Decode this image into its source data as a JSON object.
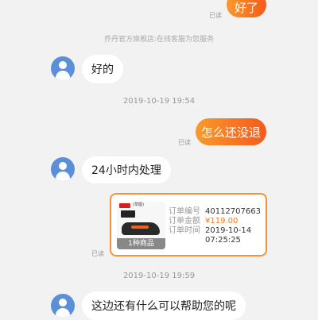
{
  "messages": {
    "m1": {
      "text": "好了",
      "read": "已读"
    },
    "system_notice": "乔丹官方旗舰店:在线客服为您服务",
    "m2": {
      "text": "好的"
    },
    "ts1": "2019-10-19 19:54",
    "m3": {
      "text": "怎么还没退",
      "read": "已读"
    },
    "m4": {
      "text": "24小时内处理"
    },
    "order_card": {
      "thumb_count": "1种商品",
      "brand_label": "(草图)",
      "order_no_label": "订单编号",
      "order_no": "40112707663",
      "amount_label": "订单金额",
      "amount": "¥119.00",
      "time_label": "订单时间",
      "time_date": "2019-10-14",
      "time_clock": "07:25:25",
      "read": "已读"
    },
    "ts2": "2019-10-19 19:59",
    "m5": {
      "text": "这边还有什么可以帮助您的呢"
    }
  },
  "colors": {
    "accent_start": "#f89a2c",
    "accent_end": "#f45a1c",
    "card_border": "#f7913b",
    "avatar": "#5b8fd8",
    "background": "#f2f2f2"
  },
  "icons": {
    "avatar": "user-avatar-icon"
  }
}
